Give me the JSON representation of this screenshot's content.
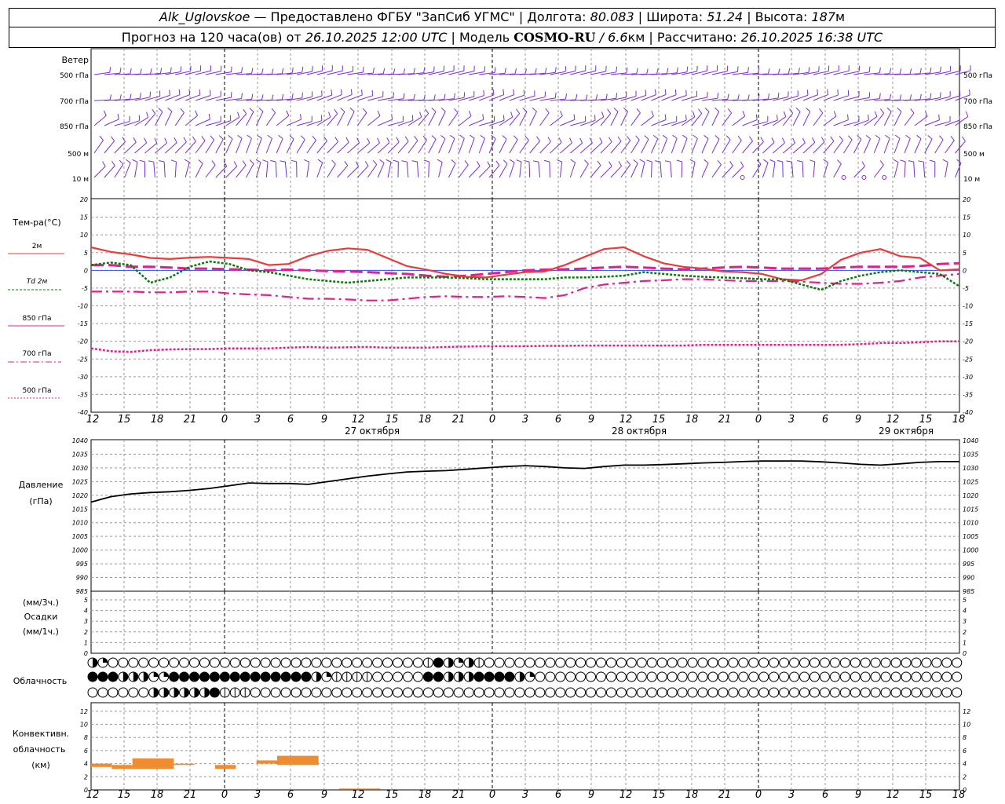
{
  "header": {
    "station": "Alk_Uglovskoe",
    "provider": "— Предоставлено ФГБУ \"ЗапСиб УГМС\" |",
    "lon_label": "Долгота:",
    "lon_value": "80.083",
    "lat_label": "| Широта:",
    "lat_value": "51.24",
    "alt_label": "| Высота:",
    "alt_value": "187",
    "alt_unit": "м",
    "forecast_prefix": "Прогноз на 120 часа(ов) от",
    "forecast_time": "26.10.2025 12:00 UTC",
    "model_label": "| Модель",
    "model_name": "COSMO-RU",
    "model_res": "/ 6.6",
    "model_res_unit": "км",
    "calc_label": "| Рассчитано:",
    "calc_time": "26.10.2025 16:38 UTC"
  },
  "time_axis": {
    "ticks": [
      "12",
      "15",
      "18",
      "21",
      "0",
      "3",
      "6",
      "9",
      "12",
      "15",
      "18",
      "21",
      "0",
      "3",
      "6",
      "9",
      "12",
      "15",
      "18",
      "21",
      "0",
      "3",
      "6",
      "9",
      "12",
      "15",
      "18"
    ],
    "date_labels": [
      "27 октября",
      "28 октября",
      "29 октября"
    ]
  },
  "wind_panel": {
    "title": "Ветер",
    "levels": [
      "500 гПа",
      "700 гПа",
      "850 гПа",
      "500 м",
      "10  м"
    ]
  },
  "temp_panel": {
    "title": "Тем-ра(°C)",
    "legend": [
      {
        "label": "2м",
        "color": "#e83c3c",
        "style": "solid"
      },
      {
        "label": "Td  2м",
        "color": "#0a7a0a",
        "style": "dotted"
      },
      {
        "label": "850 гПа",
        "color": "#e0208c",
        "style": "longdash"
      },
      {
        "label": "700 гПа",
        "color": "#e0208c",
        "style": "dashdot"
      },
      {
        "label": "500 гПа",
        "color": "#e0208c",
        "style": "dots"
      }
    ],
    "yticks": [
      "20",
      "15",
      "10",
      "5",
      "0",
      "-5",
      "-10",
      "-15",
      "-20",
      "-25",
      "-30",
      "-35",
      "-40"
    ]
  },
  "pressure_panel": {
    "title": "Давление",
    "unit": "(гПа)",
    "yticks": [
      "1040",
      "1035",
      "1030",
      "1025",
      "1020",
      "1015",
      "1010",
      "1005",
      "1000",
      "995",
      "990",
      "985"
    ]
  },
  "precip_panel": {
    "title_top": "(мм/3ч.)",
    "title": "Осадки",
    "title_bottom": "(мм/1ч.)",
    "yticks": [
      "5",
      "4",
      "3",
      "2",
      "1",
      "0"
    ]
  },
  "cloud_panel": {
    "title": "Облачность"
  },
  "conv_panel": {
    "title_1": "Конвективн.",
    "title_2": "облачность",
    "unit": "(км)",
    "yticks": [
      "12",
      "10",
      "8",
      "6",
      "4",
      "2",
      "0"
    ],
    "color": "#f08c30"
  },
  "chart_data": [
    {
      "type": "line",
      "title": "Тем-ра(°C)",
      "ylim": [
        -40,
        20
      ],
      "x_hours": [
        0,
        3,
        6,
        9,
        12,
        15,
        18,
        21,
        24,
        27,
        30,
        33,
        36,
        39,
        42,
        45,
        48,
        51,
        54,
        57,
        60,
        63,
        66,
        69,
        72,
        75,
        78,
        81,
        84,
        87,
        90,
        93,
        96,
        99,
        102,
        105,
        108,
        111,
        114,
        117,
        120,
        123,
        126
      ],
      "series": [
        {
          "name": "2м",
          "values": [
            6.5,
            5.2,
            4.5,
            3.5,
            3.2,
            3.6,
            3.8,
            3.5,
            3.2,
            1.5,
            1.8,
            4,
            5.5,
            6.2,
            5.8,
            3.5,
            1.2,
            0.2,
            -1,
            -1.8,
            -2,
            -1.2,
            -0.5,
            -0.3,
            1.5,
            3.8,
            6,
            6.5,
            4,
            2,
            1,
            0.5,
            -0.3,
            -0.5,
            -1,
            -2.5,
            -2.8,
            -1,
            3,
            5,
            6,
            4,
            3.5,
            0,
            0.3
          ]
        },
        {
          "name": "Td  2м",
          "values": [
            1.5,
            2.2,
            1.5,
            -3.5,
            -2,
            1,
            2.5,
            1.8,
            0,
            -0.5,
            -1.5,
            -2.5,
            -3,
            -3.5,
            -3,
            -2.5,
            -2,
            -2,
            -2,
            -2.2,
            -2.5,
            -2.5,
            -2.5,
            -2.5,
            -2,
            -2,
            -1.8,
            -1.5,
            -0.5,
            -1,
            -1.5,
            -1.8,
            -2,
            -2.2,
            -2.5,
            -2.5,
            -4,
            -5.5,
            -3,
            -1.5,
            -0.5,
            0,
            -0.5,
            -1,
            -4.5
          ]
        },
        {
          "name": "850 гПа",
          "values": [
            1.5,
            1.5,
            1,
            1,
            0.8,
            0.5,
            0.5,
            0.3,
            0.2,
            0,
            0.2,
            0,
            -0.2,
            -0.3,
            -0.5,
            -0.8,
            -1,
            -1.5,
            -1.8,
            -1.5,
            -1,
            -0.5,
            0,
            0.2,
            0.3,
            0.5,
            0.8,
            1,
            0.8,
            0.5,
            0.3,
            0.5,
            0.8,
            1,
            0.8,
            0.5,
            0.5,
            0.5,
            0.8,
            1,
            1,
            1,
            1.2,
            1.8,
            2
          ]
        },
        {
          "name": "700 гПа",
          "values": [
            -6,
            -6,
            -6,
            -6.2,
            -6.2,
            -6,
            -6,
            -6.5,
            -6.8,
            -7,
            -7.5,
            -8,
            -8,
            -8.2,
            -8.5,
            -8.5,
            -8,
            -7.5,
            -7.3,
            -7.5,
            -7.5,
            -7.3,
            -7.5,
            -7.8,
            -7,
            -5,
            -4,
            -3.5,
            -3,
            -2.8,
            -2.5,
            -2.5,
            -2.8,
            -3,
            -3,
            -3,
            -3.2,
            -3.5,
            -3.8,
            -3.8,
            -3.5,
            -3,
            -2,
            -1.5,
            -1
          ]
        },
        {
          "name": "500 гПа",
          "values": [
            -22,
            -22.8,
            -23,
            -22.5,
            -22.3,
            -22.2,
            -22.2,
            -22,
            -22,
            -22,
            -21.8,
            -21.6,
            -21.8,
            -21.7,
            -21.6,
            -21.8,
            -21.8,
            -21.8,
            -21.6,
            -21.5,
            -21.4,
            -21.4,
            -21.4,
            -21.3,
            -21.3,
            -21.2,
            -21.2,
            -21.2,
            -21.2,
            -21.2,
            -21.2,
            -21,
            -21,
            -21,
            -21,
            -21,
            -21,
            -21,
            -21,
            -20.8,
            -20.5,
            -20.5,
            -20.3,
            -20,
            -20
          ]
        }
      ]
    },
    {
      "type": "line",
      "title": "Давление",
      "ylim": [
        985,
        1040
      ],
      "x_hours": [
        0,
        3,
        6,
        9,
        12,
        15,
        18,
        21,
        24,
        27,
        30,
        33,
        36,
        39,
        42,
        45,
        48,
        51,
        54,
        57,
        60,
        63,
        66,
        69,
        72,
        75,
        78,
        81,
        84,
        87,
        90,
        93,
        96,
        99,
        102,
        105,
        108,
        111,
        114,
        117,
        120,
        123,
        126
      ],
      "series": [
        {
          "name": "",
          "values": [
            1017.5,
            1019.5,
            1020.5,
            1021,
            1021.3,
            1021.8,
            1022.5,
            1023.5,
            1024.5,
            1024.3,
            1024.3,
            1024,
            1025,
            1026,
            1027,
            1027.8,
            1028.5,
            1028.8,
            1029,
            1029.5,
            1030,
            1030.5,
            1030.8,
            1030.5,
            1030,
            1029.8,
            1030.5,
            1031,
            1031,
            1031.2,
            1031.5,
            1031.8,
            1032,
            1032.3,
            1032.5,
            1032.5,
            1032.5,
            1032.2,
            1031.8,
            1031.3,
            1031,
            1031.5,
            1032,
            1032.3,
            1032.3
          ]
        }
      ]
    },
    {
      "type": "bar",
      "title": "Конвективн. облачность",
      "ylim": [
        0,
        13
      ],
      "bars": [
        {
          "x0": 0,
          "x1": 1,
          "bottom": 3.5,
          "top": 4.0
        },
        {
          "x0": 1,
          "x1": 2,
          "bottom": 3.2,
          "top": 3.8
        },
        {
          "x0": 2,
          "x1": 4,
          "bottom": 3.2,
          "top": 4.8
        },
        {
          "x0": 4,
          "x1": 5,
          "bottom": 3.8,
          "top": 4.0
        },
        {
          "x0": 6,
          "x1": 7,
          "bottom": 3.2,
          "top": 3.8
        },
        {
          "x0": 8,
          "x1": 9,
          "bottom": 4.0,
          "top": 4.5
        },
        {
          "x0": 9,
          "x1": 11,
          "bottom": 3.8,
          "top": 5.2
        },
        {
          "x0": 12,
          "x1": 14,
          "bottom": 0.1,
          "top": 0.2
        }
      ]
    }
  ],
  "wind_rows": {
    "color": "#7a2ed6",
    "rows": [
      "500",
      "700",
      "850",
      "500m",
      "10m"
    ]
  },
  "cloud_rows": {
    "rows": [
      [
        3,
        2,
        0,
        0,
        0,
        0,
        0,
        0,
        0,
        0,
        0,
        0,
        0,
        0,
        0,
        0,
        0,
        0,
        0,
        0,
        0,
        0,
        0,
        0,
        0,
        0,
        0,
        0,
        0,
        0,
        0,
        0,
        0,
        1,
        4,
        3,
        2,
        3,
        1,
        0,
        0,
        0,
        0,
        0,
        0,
        0,
        0,
        0,
        0,
        0,
        0,
        0,
        0,
        0,
        0,
        0,
        0,
        0,
        0,
        0,
        0,
        0,
        0,
        0,
        0,
        0,
        0,
        0,
        0,
        0,
        0,
        0,
        0,
        0,
        0,
        0,
        0,
        0,
        0,
        0,
        0,
        0,
        0,
        0,
        0,
        0,
        0,
        0
      ],
      [
        4,
        4,
        4,
        3,
        3,
        3,
        2,
        2,
        4,
        4,
        4,
        4,
        4,
        4,
        4,
        4,
        4,
        4,
        4,
        4,
        4,
        4,
        3,
        2,
        1,
        1,
        1,
        1,
        0,
        0,
        0,
        0,
        0,
        4,
        4,
        3,
        3,
        3,
        4,
        4,
        4,
        4,
        3,
        2,
        0,
        0,
        0,
        0,
        0,
        0,
        0,
        0,
        0,
        0,
        0,
        0,
        0,
        0,
        0,
        0,
        0,
        0,
        0,
        0,
        0,
        0,
        0,
        0,
        0,
        0,
        0,
        0,
        0,
        0,
        0,
        0,
        0,
        0,
        0,
        0,
        0,
        0,
        0,
        0,
        0,
        0,
        0,
        0
      ],
      [
        0,
        0,
        0,
        0,
        0,
        0,
        3,
        3,
        3,
        3,
        3,
        3,
        4,
        1,
        1,
        1,
        0,
        0,
        0,
        0,
        0,
        0,
        0,
        0,
        0,
        0,
        0,
        0,
        0,
        0,
        0,
        0,
        0,
        0,
        0,
        0,
        0,
        0,
        0,
        0,
        0,
        0,
        0,
        0,
        0,
        0,
        0,
        0,
        0,
        0,
        0,
        0,
        0,
        0,
        0,
        0,
        0,
        0,
        0,
        0,
        0,
        0,
        0,
        0,
        0,
        0,
        0,
        0,
        0,
        0,
        0,
        0,
        0,
        0,
        0,
        0,
        0,
        0,
        0,
        0,
        0,
        0,
        0,
        0,
        0,
        0,
        0,
        0
      ]
    ]
  }
}
